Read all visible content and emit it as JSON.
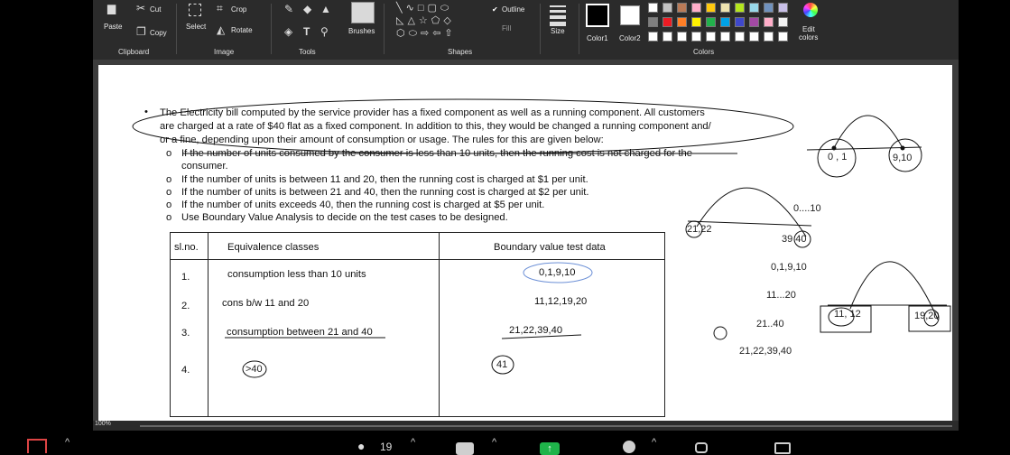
{
  "ribbon": {
    "clipboard": {
      "paste": "Paste",
      "cut": "Cut",
      "copy": "Copy",
      "label": "Clipboard"
    },
    "image": {
      "select": "Select",
      "crop": "Crop",
      "rotate": "Rotate",
      "label": "Image"
    },
    "tools": {
      "label": "Tools"
    },
    "brushes": {
      "label": "Brushes"
    },
    "shapes": {
      "outline": "Outline",
      "fill": "Fill",
      "label": "Shapes"
    },
    "size": {
      "label": "Size"
    },
    "colors": {
      "color1": "Color1",
      "color2": "Color2",
      "edit_line1": "Edit",
      "edit_line2": "colors",
      "label": "Colors",
      "palette_top": [
        "#ffffff",
        "#c3c3c3",
        "#b97a57",
        "#ffaec9",
        "#ffc90e",
        "#efe4b0",
        "#b5e61d",
        "#99d9ea",
        "#7092be",
        "#c8bfe7"
      ],
      "palette_mid": [
        "#7f7f7f",
        "#ed1c24",
        "#ff7f27",
        "#fff200",
        "#22b14c",
        "#00a2e8",
        "#3f48cc",
        "#a349a4",
        "#ffaec9",
        "#f2f2f2"
      ]
    }
  },
  "document": {
    "bullet": "•",
    "intro": [
      "The Electricity bill computed by the service provider has a fixed component as well as a running component. All customers",
      "are charged at a rate of $40 flat as a fixed component. In addition to this, they would be changed a running component and/",
      "or a fine, depending upon their amount of consumption or usage. The rules for this are given below:"
    ],
    "sub_bullet": "o",
    "rules": [
      "If the number of units consumed by the consumer is less than 10 units, then the running cost is not charged for the",
      "consumer.",
      "If the number of units is between 11 and 20, then the running cost is charged at $1 per unit.",
      "If the number of units is between 21 and 40, then the running cost is charged at $2 per unit.",
      "If the number of units exceeds 40, then the running cost is charged at $5 per unit.",
      "Use Boundary Value Analysis to decide on the test cases to be designed."
    ],
    "table": {
      "headers": [
        "sl.no.",
        "Equivalence classes",
        "Boundary value test data"
      ],
      "rows": [
        {
          "no": "1.",
          "eq": "consumption less than 10 units",
          "bv": "0,1,9,10"
        },
        {
          "no": "2.",
          "eq": "cons b/w 11 and 20",
          "bv": "11,12,19,20"
        },
        {
          "no": "3.",
          "eq": "consumption between 21 and 40",
          "bv": "21,22,39,40"
        },
        {
          "no": "4.",
          "eq": ">40",
          "bv": "41"
        }
      ]
    },
    "annotations": {
      "range_0_10": "0....10",
      "pt_0_1": "0 , 1",
      "pt_9_10": "9,10",
      "pt_21_22": "21,22",
      "pt_39_40": "39 40",
      "list_0_1_9_10": "0,1,9,10",
      "range_11_20": "11...20",
      "range_21_40": "21..40",
      "list_21_40": "21,22,39,40",
      "pt_11_12": "11, 12",
      "pt_19_20": "19,20"
    }
  },
  "status": {
    "zoom": "100%"
  },
  "meeting_bar": {
    "participants": "19"
  }
}
